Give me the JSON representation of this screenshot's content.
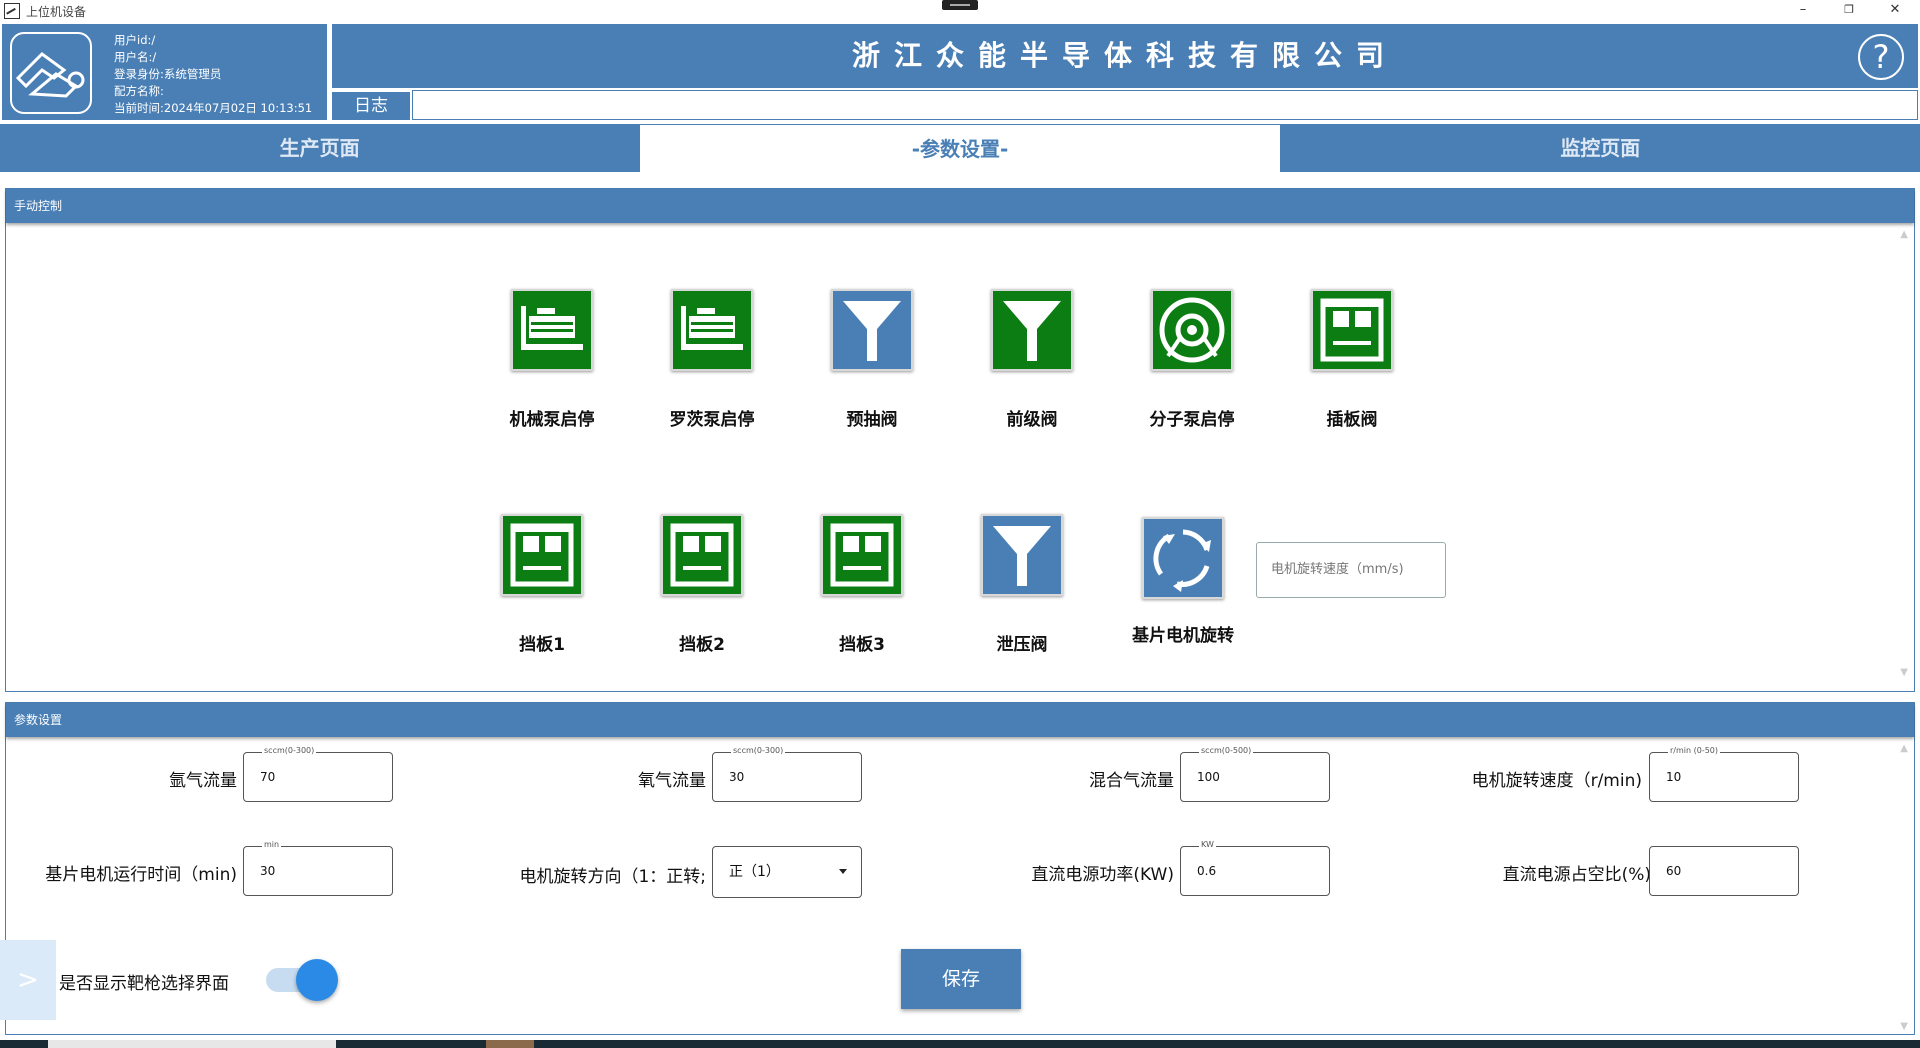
{
  "window": {
    "title": "上位机设备",
    "minimize": "–",
    "restore": "❐",
    "close": "✕"
  },
  "header": {
    "user_id": "用户id:/",
    "user_name": "用户名:/",
    "role": "登录身份:系统管理员",
    "recipe": "配方名称:",
    "time": "当前时间:2024年07月02日 10:13:51",
    "company": "浙江众能半导体科技有限公司",
    "help": "?",
    "log_label": "日志",
    "log_value": ""
  },
  "nav": {
    "tabs": [
      {
        "label": "生产页面"
      },
      {
        "label": "-参数设置-"
      },
      {
        "label": "监控页面"
      }
    ],
    "active": 1
  },
  "manual": {
    "title": "手动控制",
    "controls": [
      {
        "label": "机械泵启停",
        "icon": "pump-icon",
        "color": "green"
      },
      {
        "label": "罗茨泵启停",
        "icon": "pump-icon",
        "color": "green"
      },
      {
        "label": "预抽阀",
        "icon": "valve-icon",
        "color": "blue"
      },
      {
        "label": "前级阀",
        "icon": "valve-icon",
        "color": "green"
      },
      {
        "label": "分子泵启停",
        "icon": "molecular-pump-icon",
        "color": "green"
      },
      {
        "label": "插板阀",
        "icon": "gate-valve-icon",
        "color": "green"
      },
      {
        "label": "挡板1",
        "icon": "shutter-icon",
        "color": "green"
      },
      {
        "label": "挡板2",
        "icon": "shutter-icon",
        "color": "green"
      },
      {
        "label": "挡板3",
        "icon": "shutter-icon",
        "color": "green"
      },
      {
        "label": "泄压阀",
        "icon": "valve-icon",
        "color": "blue"
      },
      {
        "label": "基片电机旋转",
        "icon": "rotate-icon",
        "color": "blue"
      }
    ],
    "speed_placeholder": "电机旋转速度（mm/s)"
  },
  "params": {
    "title": "参数设置",
    "fields": [
      {
        "label": "氩气流量",
        "hint": "sccm(0-300)",
        "value": "70"
      },
      {
        "label": "氧气流量",
        "hint": "sccm(0-300)",
        "value": "30"
      },
      {
        "label": "混合气流量",
        "hint": "sccm(0-500)",
        "value": "100"
      },
      {
        "label": "电机旋转速度（r/min)",
        "hint": "r/min (0-50)",
        "value": "10"
      },
      {
        "label": "基片电机运行时间（min)",
        "hint": "min",
        "value": "30"
      },
      {
        "label": "电机旋转方向（1：正转;",
        "hint": "",
        "value": "正（1）"
      },
      {
        "label": "直流电源功率(KW)",
        "hint": "KW",
        "value": "0.6"
      },
      {
        "label": "直流电源占空比(%)",
        "hint": "",
        "value": "60"
      }
    ],
    "toggle_label": "是否显示靶枪选择界面",
    "toggle_on": true,
    "save_label": "保存"
  },
  "side_arrow": ">",
  "colors": {
    "primary": "#4a7fb5",
    "green": "#0b7d12",
    "toggle": "#2b8ae6"
  }
}
